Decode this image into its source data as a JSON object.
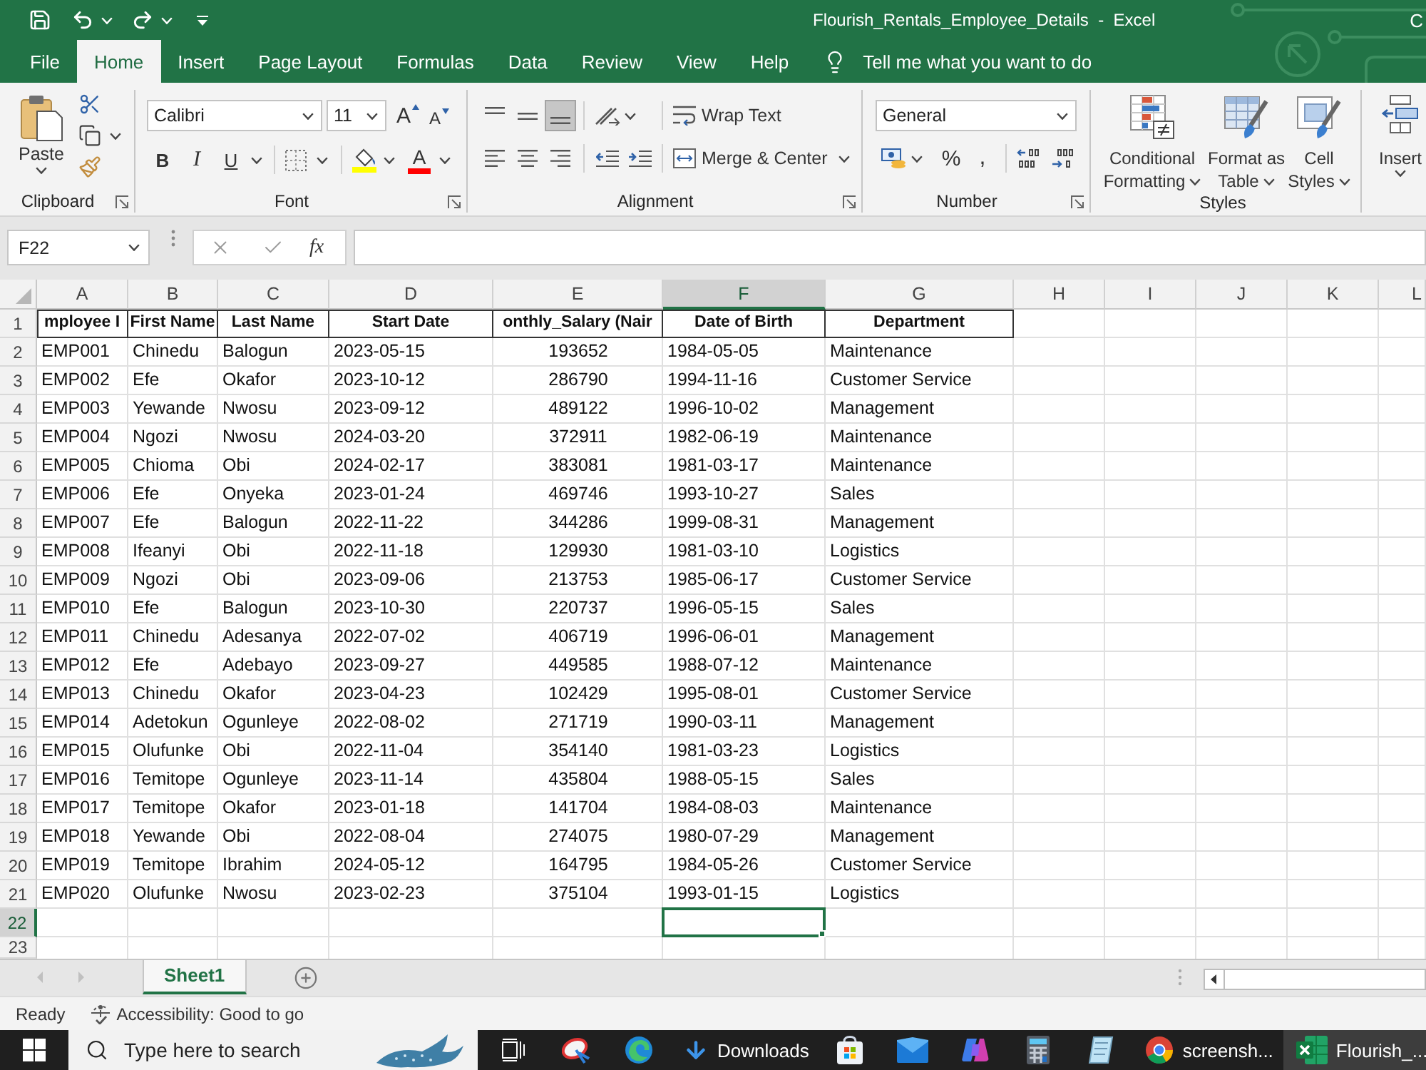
{
  "title_bar": {
    "title": "Flourish_Rentals_Employee_Details  -  Excel",
    "account_initial": "C"
  },
  "menu_tabs": [
    {
      "label": "File",
      "selected": false
    },
    {
      "label": "Home",
      "selected": true
    },
    {
      "label": "Insert",
      "selected": false
    },
    {
      "label": "Page Layout",
      "selected": false
    },
    {
      "label": "Formulas",
      "selected": false
    },
    {
      "label": "Data",
      "selected": false
    },
    {
      "label": "Review",
      "selected": false
    },
    {
      "label": "View",
      "selected": false
    },
    {
      "label": "Help",
      "selected": false
    }
  ],
  "tell_me": {
    "placeholder": "Tell me what you want to do"
  },
  "ribbon": {
    "clipboard": {
      "paste": "Paste",
      "label": "Clipboard"
    },
    "font": {
      "font_name": "Calibri",
      "font_size": "11",
      "grow_glyph": "A",
      "shrink_glyph": "A",
      "bold": "B",
      "italic": "I",
      "underline": "U",
      "font_color_glyph": "A",
      "label": "Font"
    },
    "alignment": {
      "vertical": [
        {
          "kind": "top",
          "selected": false
        },
        {
          "kind": "middle",
          "selected": false
        },
        {
          "kind": "bottom",
          "selected": true
        }
      ],
      "horizontal": [
        {
          "kind": "left",
          "selected": false
        },
        {
          "kind": "center",
          "selected": false
        },
        {
          "kind": "right",
          "selected": false
        }
      ],
      "wrap_text": "Wrap Text",
      "merge_center": "Merge & Center",
      "label": "Alignment"
    },
    "number": {
      "format": "General",
      "percent": "%",
      "comma": ",",
      "label": "Number"
    },
    "styles": {
      "buttons": [
        {
          "kind": "conditional",
          "lines": [
            "Conditional",
            "Formatting"
          ]
        },
        {
          "kind": "table",
          "lines": [
            "Format as",
            "Table"
          ]
        },
        {
          "kind": "cell",
          "lines": [
            "Cell",
            "Styles"
          ]
        }
      ],
      "label": "Styles"
    },
    "cells": {
      "insert": "Insert"
    }
  },
  "formula_bar": {
    "name_box": "F22",
    "function_glyph": "fx"
  },
  "sheet": {
    "columns": [
      {
        "label": "A",
        "selected": false
      },
      {
        "label": "B",
        "selected": false
      },
      {
        "label": "C",
        "selected": false
      },
      {
        "label": "D",
        "selected": false
      },
      {
        "label": "E",
        "selected": false
      },
      {
        "label": "F",
        "selected": true
      },
      {
        "label": "G",
        "selected": false
      },
      {
        "label": "H",
        "selected": false
      },
      {
        "label": "I",
        "selected": false
      },
      {
        "label": "J",
        "selected": false
      },
      {
        "label": "K",
        "selected": false
      },
      {
        "label": "L",
        "selected": false
      }
    ],
    "rows": [
      {
        "number": "1",
        "selected": false,
        "kind": "header",
        "cells": [
          "mployee I",
          "First Name",
          "Last Name",
          "Start Date",
          "onthly_Salary (Nair",
          "Date of Birth",
          "Department"
        ]
      },
      {
        "number": "2",
        "selected": false,
        "kind": "data",
        "cells": [
          "EMP001",
          "Chinedu",
          "Balogun",
          "2023-05-15",
          "193652",
          "1984-05-05",
          "Maintenance"
        ]
      },
      {
        "number": "3",
        "selected": false,
        "kind": "data",
        "cells": [
          "EMP002",
          "Efe",
          "Okafor",
          "2023-10-12",
          "286790",
          "1994-11-16",
          "Customer Service"
        ]
      },
      {
        "number": "4",
        "selected": false,
        "kind": "data",
        "cells": [
          "EMP003",
          "Yewande",
          "Nwosu",
          "2023-09-12",
          "489122",
          "1996-10-02",
          "Management"
        ]
      },
      {
        "number": "5",
        "selected": false,
        "kind": "data",
        "cells": [
          "EMP004",
          "Ngozi",
          "Nwosu",
          "2024-03-20",
          "372911",
          "1982-06-19",
          "Maintenance"
        ]
      },
      {
        "number": "6",
        "selected": false,
        "kind": "data",
        "cells": [
          "EMP005",
          "Chioma",
          "Obi",
          "2024-02-17",
          "383081",
          "1981-03-17",
          "Maintenance"
        ]
      },
      {
        "number": "7",
        "selected": false,
        "kind": "data",
        "cells": [
          "EMP006",
          "Efe",
          "Onyeka",
          "2023-01-24",
          "469746",
          "1993-10-27",
          "Sales"
        ]
      },
      {
        "number": "8",
        "selected": false,
        "kind": "data",
        "cells": [
          "EMP007",
          "Efe",
          "Balogun",
          "2022-11-22",
          "344286",
          "1999-08-31",
          "Management"
        ]
      },
      {
        "number": "9",
        "selected": false,
        "kind": "data",
        "cells": [
          "EMP008",
          "Ifeanyi",
          "Obi",
          "2022-11-18",
          "129930",
          "1981-03-10",
          "Logistics"
        ]
      },
      {
        "number": "10",
        "selected": false,
        "kind": "data",
        "cells": [
          "EMP009",
          "Ngozi",
          "Obi",
          "2023-09-06",
          "213753",
          "1985-06-17",
          "Customer Service"
        ]
      },
      {
        "number": "11",
        "selected": false,
        "kind": "data",
        "cells": [
          "EMP010",
          "Efe",
          "Balogun",
          "2023-10-30",
          "220737",
          "1996-05-15",
          "Sales"
        ]
      },
      {
        "number": "12",
        "selected": false,
        "kind": "data",
        "cells": [
          "EMP011",
          "Chinedu",
          "Adesanya",
          "2022-07-02",
          "406719",
          "1996-06-01",
          "Management"
        ]
      },
      {
        "number": "13",
        "selected": false,
        "kind": "data",
        "cells": [
          "EMP012",
          "Efe",
          "Adebayo",
          "2023-09-27",
          "449585",
          "1988-07-12",
          "Maintenance"
        ]
      },
      {
        "number": "14",
        "selected": false,
        "kind": "data",
        "cells": [
          "EMP013",
          "Chinedu",
          "Okafor",
          "2023-04-23",
          "102429",
          "1995-08-01",
          "Customer Service"
        ]
      },
      {
        "number": "15",
        "selected": false,
        "kind": "data",
        "cells": [
          "EMP014",
          "Adetokun",
          "Ogunleye",
          "2022-08-02",
          "271719",
          "1990-03-11",
          "Management"
        ]
      },
      {
        "number": "16",
        "selected": false,
        "kind": "data",
        "cells": [
          "EMP015",
          "Olufunke",
          "Obi",
          "2022-11-04",
          "354140",
          "1981-03-23",
          "Logistics"
        ]
      },
      {
        "number": "17",
        "selected": false,
        "kind": "data",
        "cells": [
          "EMP016",
          "Temitope",
          "Ogunleye",
          "2023-11-14",
          "435804",
          "1988-05-15",
          "Sales"
        ]
      },
      {
        "number": "18",
        "selected": false,
        "kind": "data",
        "cells": [
          "EMP017",
          "Temitope",
          "Okafor",
          "2023-01-18",
          "141704",
          "1984-08-03",
          "Maintenance"
        ]
      },
      {
        "number": "19",
        "selected": false,
        "kind": "data",
        "cells": [
          "EMP018",
          "Yewande",
          "Obi",
          "2022-08-04",
          "274075",
          "1980-07-29",
          "Management"
        ]
      },
      {
        "number": "20",
        "selected": false,
        "kind": "data",
        "cells": [
          "EMP019",
          "Temitope",
          "Ibrahim",
          "2024-05-12",
          "164795",
          "1984-05-26",
          "Customer Service"
        ]
      },
      {
        "number": "21",
        "selected": false,
        "kind": "data",
        "cells": [
          "EMP020",
          "Olufunke",
          "Nwosu",
          "2023-02-23",
          "375104",
          "1993-01-15",
          "Logistics"
        ]
      },
      {
        "number": "22",
        "selected": true,
        "kind": "empty"
      },
      {
        "number": "23",
        "selected": false,
        "kind": "empty"
      }
    ]
  },
  "sheet_tabs": [
    {
      "label": "Sheet1",
      "selected": true
    }
  ],
  "status_bar": {
    "mode": "Ready",
    "accessibility": "Accessibility: Good to go"
  },
  "taskbar": {
    "search": {
      "placeholder": "Type here to search"
    },
    "items": [
      {
        "kind": "task_view",
        "selected": false
      },
      {
        "kind": "disc_app",
        "selected": false
      },
      {
        "kind": "swirl_browser",
        "selected": false
      },
      {
        "kind": "downloads",
        "label": "Downloads",
        "selected": false
      },
      {
        "kind": "store",
        "selected": false
      },
      {
        "kind": "mail",
        "selected": false
      },
      {
        "kind": "loop_app",
        "selected": false
      },
      {
        "kind": "calculator",
        "selected": false
      },
      {
        "kind": "notepad",
        "selected": false
      },
      {
        "kind": "circle_browser",
        "label": "screensh...",
        "selected": false
      },
      {
        "kind": "spreadsheet",
        "label": "Flourish_...",
        "selected": true
      }
    ]
  }
}
